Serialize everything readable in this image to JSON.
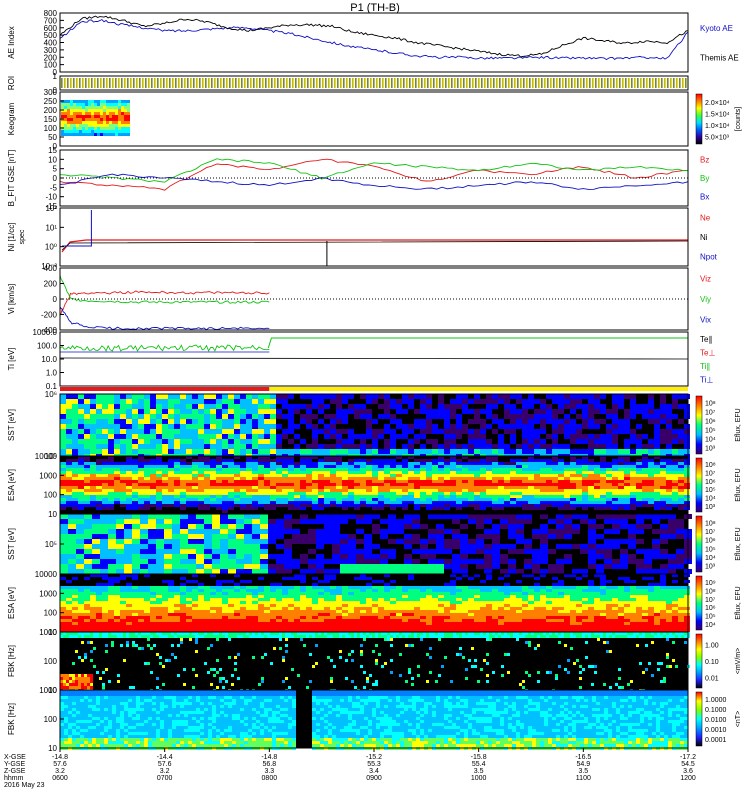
{
  "title": "P1 (TH-B)",
  "colors": {
    "black": "#000000",
    "red": "#e41a1c",
    "green": "#11c311",
    "blue": "#1010c8",
    "yellow": "#ffee00",
    "cyan": "#00c8c8"
  },
  "chart_data": [
    {
      "type": "line",
      "panel": "ae",
      "ylabel": "AE Index",
      "yticks": [
        "0",
        "100",
        "200",
        "300",
        "400",
        "500",
        "600",
        "700",
        "800"
      ],
      "ylim": [
        0,
        800
      ],
      "legend": [
        {
          "name": "Kyoto AE",
          "color": "blue"
        },
        {
          "name": "Themis AE",
          "color": "black"
        }
      ],
      "x_hours": [
        6.0,
        6.2,
        6.4,
        6.6,
        6.8,
        7.0,
        7.2,
        7.4,
        7.6,
        7.8,
        8.0,
        8.2,
        8.4,
        8.6,
        8.8,
        9.0,
        9.2,
        9.4,
        9.6,
        9.8,
        10.0,
        10.2,
        10.4,
        10.6,
        10.8,
        11.0,
        11.2,
        11.4,
        11.6,
        11.8,
        12.0
      ],
      "series": [
        {
          "name": "Kyoto AE",
          "color": "blue",
          "values": [
            450,
            680,
            700,
            640,
            600,
            560,
            560,
            580,
            600,
            600,
            560,
            520,
            460,
            400,
            340,
            300,
            260,
            220,
            200,
            200,
            190,
            190,
            190,
            200,
            190,
            190,
            180,
            190,
            200,
            180,
            540
          ]
        },
        {
          "name": "Themis AE",
          "color": "black",
          "values": [
            500,
            720,
            760,
            700,
            620,
            660,
            720,
            680,
            600,
            560,
            600,
            640,
            640,
            620,
            540,
            500,
            460,
            400,
            360,
            320,
            280,
            240,
            220,
            240,
            360,
            460,
            420,
            390,
            420,
            400,
            560
          ]
        }
      ]
    },
    {
      "type": "bar",
      "panel": "roi",
      "ylabel": "ROI",
      "ylim": [
        0,
        1
      ],
      "yticks": [
        "0",
        "1"
      ]
    },
    {
      "type": "heatmap",
      "panel": "keogram",
      "ylabel": "Keogram",
      "yticks": [
        "0",
        "50",
        "100",
        "150",
        "200",
        "250",
        "300"
      ],
      "ylim": [
        0,
        300
      ],
      "x_hours_range": [
        6.0,
        6.65
      ],
      "colorbar": {
        "label": "[counts]",
        "ticks": [
          "5.0×10³",
          "1.0×10⁴",
          "1.5×10⁴",
          "2.0×10⁴"
        ]
      }
    },
    {
      "type": "line",
      "panel": "bfield",
      "ylabel": "B_FIT GSE [nT]",
      "yticks": [
        "-15",
        "-10",
        "-5",
        "0",
        "5",
        "10",
        "15"
      ],
      "ylim": [
        -15,
        15
      ],
      "legend": [
        {
          "name": "Bz",
          "color": "red"
        },
        {
          "name": "By",
          "color": "green"
        },
        {
          "name": "Bx",
          "color": "blue"
        }
      ],
      "x_hours": [
        6.0,
        6.5,
        7.0,
        7.5,
        8.0,
        8.5,
        9.0,
        9.5,
        10.0,
        10.5,
        11.0,
        11.5,
        12.0
      ],
      "series": [
        {
          "name": "Bz",
          "color": "red",
          "values": [
            -2,
            -4,
            -6,
            8,
            4,
            10,
            6,
            -2,
            4,
            2,
            6,
            0,
            4
          ]
        },
        {
          "name": "By",
          "color": "green",
          "values": [
            2,
            0,
            -2,
            10,
            8,
            0,
            8,
            6,
            4,
            8,
            4,
            6,
            4
          ]
        },
        {
          "name": "Bx",
          "color": "blue",
          "values": [
            -4,
            2,
            0,
            -2,
            -4,
            0,
            -4,
            -6,
            -4,
            -2,
            -6,
            -4,
            -2
          ]
        }
      ]
    },
    {
      "type": "line",
      "panel": "density",
      "ylabel": "Ni [1/cc]",
      "ylabel2": "spec",
      "yticks": [
        "10⁻³",
        "10⁰",
        "10¹",
        "10²"
      ],
      "ylog": true,
      "legend": [
        {
          "name": "Ne",
          "color": "red"
        },
        {
          "name": "Ni",
          "color": "black"
        },
        {
          "name": "Npot",
          "color": "blue"
        }
      ]
    },
    {
      "type": "line",
      "panel": "velocity",
      "ylabel": "Vi [km/s]",
      "yticks": [
        "-400",
        "-200",
        "0",
        "200",
        "400"
      ],
      "ylim": [
        -400,
        400
      ],
      "legend": [
        {
          "name": "Viz",
          "color": "red"
        },
        {
          "name": "Viy",
          "color": "green"
        },
        {
          "name": "Vix",
          "color": "blue"
        }
      ],
      "x_hours": [
        6.0,
        6.1,
        6.25,
        6.5,
        6.75,
        7.0,
        7.25,
        7.5,
        7.75,
        8.0
      ],
      "series": [
        {
          "name": "Viz",
          "color": "red",
          "values": [
            -200,
            60,
            80,
            80,
            90,
            85,
            80,
            80,
            80,
            80
          ]
        },
        {
          "name": "Viy",
          "color": "green",
          "values": [
            300,
            0,
            -20,
            -30,
            -40,
            -40,
            -40,
            -40,
            -40,
            -40
          ]
        },
        {
          "name": "Vix",
          "color": "blue",
          "values": [
            -100,
            -300,
            -360,
            -380,
            -380,
            -380,
            -380,
            -380,
            -380,
            -380
          ]
        }
      ]
    },
    {
      "type": "line",
      "panel": "temperature",
      "ylabel": "Ti [eV]",
      "yticks": [
        "0.1",
        "1.0",
        "10.0",
        "100.0",
        "1000.0"
      ],
      "ylog": true,
      "legend": [
        {
          "name": "Te∥",
          "color": "black"
        },
        {
          "name": "Te⊥",
          "color": "red"
        },
        {
          "name": "Ti∥",
          "color": "green"
        },
        {
          "name": "Ti⊥",
          "color": "blue"
        }
      ]
    },
    {
      "type": "heatmap",
      "panel": "sst_ion",
      "ylabel": "SST [eV]",
      "yticks": [
        "10⁵",
        "10⁶"
      ],
      "colorbar": {
        "label": "Eflux, EFU",
        "ticks": [
          "10³",
          "10⁴",
          "10⁵",
          "10⁶",
          "10⁷",
          "10⁸"
        ]
      }
    },
    {
      "type": "heatmap",
      "panel": "esa_ion",
      "ylabel": "ESA [eV]",
      "yticks": [
        "10",
        "100",
        "1000",
        "10000"
      ],
      "colorbar": {
        "label": "Eflux, EFU",
        "ticks": [
          "10³",
          "10⁴",
          "10⁵",
          "10⁶",
          "10⁷",
          "10⁸"
        ]
      }
    },
    {
      "type": "heatmap",
      "panel": "sst_elec",
      "ylabel": "SST [eV]",
      "yticks": [
        "10⁵"
      ],
      "colorbar": {
        "label": "Eflux, EFU",
        "ticks": [
          "10³",
          "10⁴",
          "10⁵",
          "10⁶",
          "10⁷",
          "10⁸"
        ]
      }
    },
    {
      "type": "heatmap",
      "panel": "esa_elec",
      "ylabel": "ESA [eV]",
      "yticks": [
        "10",
        "100",
        "1000",
        "10000"
      ],
      "colorbar": {
        "label": "Eflux, EFU",
        "ticks": [
          "10⁴",
          "10⁵",
          "10⁶",
          "10⁷",
          "10⁸",
          "10⁹"
        ]
      }
    },
    {
      "type": "heatmap",
      "panel": "fbk_e",
      "ylabel": "FBK [Hz]",
      "yticks": [
        "10",
        "100",
        "1000"
      ],
      "colorbar": {
        "label": "<mV/m>",
        "ticks": [
          "0.01",
          "0.10",
          "1.00"
        ]
      }
    },
    {
      "type": "heatmap",
      "panel": "fbk_b",
      "ylabel": "FBK [Hz]",
      "yticks": [
        "10",
        "100",
        "1000"
      ],
      "colorbar": {
        "label": "<nT>",
        "ticks": [
          "0.0001",
          "0.0010",
          "0.0100",
          "0.1000",
          "1.0000"
        ]
      }
    }
  ],
  "xaxis": {
    "row_labels": [
      "X-GSE",
      "Y-GSE",
      "Z-GSE",
      "hhmm",
      "2016 May 23"
    ],
    "columns": [
      {
        "x": "-14.8",
        "y": "57.6",
        "z": "3.2",
        "t": "0600"
      },
      {
        "x": "-14.4",
        "y": "57.6",
        "z": "3.2",
        "t": "0700"
      },
      {
        "x": "-14.8",
        "y": "56.8",
        "z": "3.3",
        "t": "0800"
      },
      {
        "x": "-15.2",
        "y": "55.3",
        "z": "3.4",
        "t": "0900"
      },
      {
        "x": "-15.8",
        "y": "55.4",
        "z": "3.5",
        "t": "1000"
      },
      {
        "x": "-16.5",
        "y": "54.9",
        "z": "3.5",
        "t": "1100"
      },
      {
        "x": "-17.2",
        "y": "54.5",
        "z": "3.6",
        "t": "1200"
      }
    ]
  }
}
